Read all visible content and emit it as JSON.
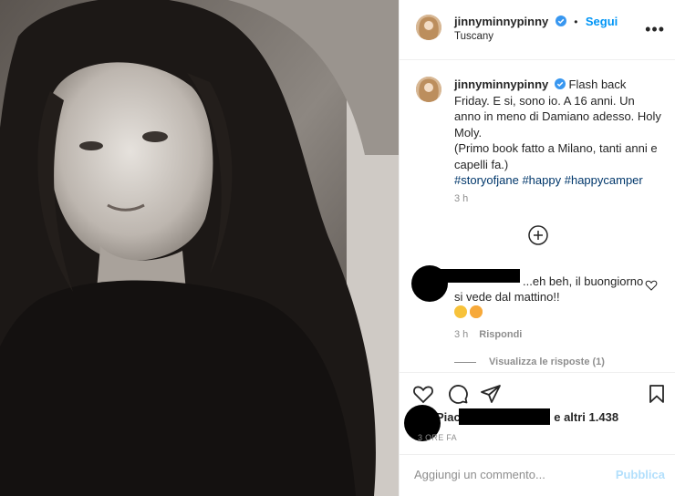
{
  "post": {
    "username": "jinnyminnypinny",
    "follow_label": "Segui",
    "separator": "•",
    "location": "Tuscany",
    "more_label": "•••"
  },
  "caption": {
    "username": "jinnyminnypinny",
    "text": "Flash back Friday. E si, sono io. A 16 anni. Un anno in meno di Damiano adesso. Holy Moly.",
    "text2": "(Primo book fatto a Milano, tanti anni e capelli fa.)",
    "tags": [
      "#storyofjane",
      "#happy",
      "#happycamper"
    ],
    "time": "3 h"
  },
  "comment": {
    "text": "...eh beh, il buongiorno si vede dal mattino!!",
    "emojis": [
      "smiling-face-emoji",
      "heart-eyes-emoji"
    ],
    "time": "3 h",
    "reply_label": "Rispondi",
    "view_replies": "Visualizza le risposte (1)"
  },
  "likes": {
    "prefix": "Piace",
    "suffix": "e altri 1.438",
    "time_label": "3 ORE FA"
  },
  "add_comment": {
    "placeholder": "Aggiungi un commento...",
    "publish_label": "Pubblica"
  },
  "colors": {
    "link_blue": "#0095f6",
    "hashtag": "#00376b",
    "muted": "#8e8e8e",
    "publish_disabled": "#b2dffc"
  }
}
